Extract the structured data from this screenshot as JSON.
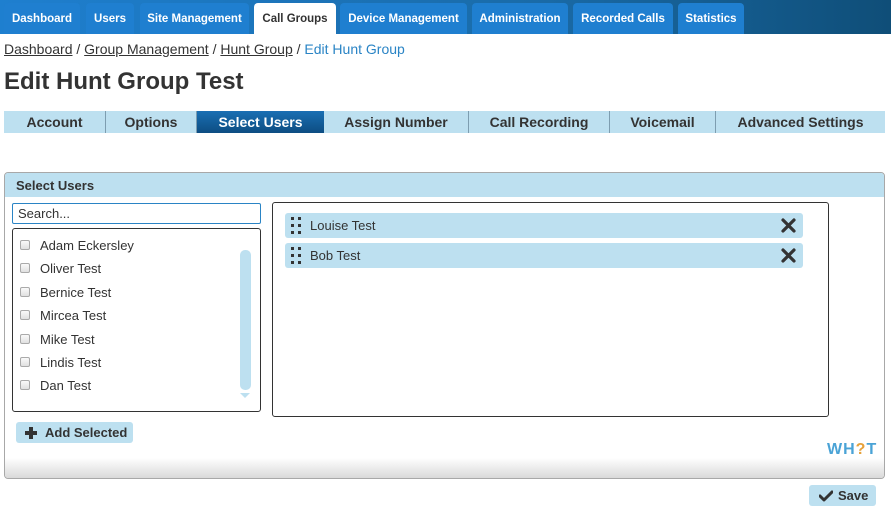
{
  "nav": {
    "tabs": [
      {
        "label": "Dashboard"
      },
      {
        "label": "Users"
      },
      {
        "label": "Site Management"
      },
      {
        "label": "Call Groups"
      },
      {
        "label": "Device Management"
      },
      {
        "label": "Administration"
      },
      {
        "label": "Recorded Calls"
      },
      {
        "label": "Statistics"
      }
    ],
    "active": "Call Groups"
  },
  "breadcrumb": {
    "items": [
      "Dashboard",
      "Group Management",
      "Hunt Group"
    ],
    "current": "Edit Hunt Group",
    "separator": "/"
  },
  "page": {
    "title": "Edit Hunt Group Test"
  },
  "subtabs": {
    "items": [
      {
        "label": "Account"
      },
      {
        "label": "Options"
      },
      {
        "label": "Select Users"
      },
      {
        "label": "Assign Number"
      },
      {
        "label": "Call Recording"
      },
      {
        "label": "Voicemail"
      },
      {
        "label": "Advanced Settings"
      }
    ],
    "active": "Select Users"
  },
  "panel": {
    "title": "Select Users",
    "search": {
      "placeholder": "Search...",
      "value": ""
    },
    "available_users": [
      {
        "name": "Adam Eckersley",
        "checked": false
      },
      {
        "name": "Oliver Test",
        "checked": false
      },
      {
        "name": "Bernice Test",
        "checked": false
      },
      {
        "name": "Mircea Test",
        "checked": false
      },
      {
        "name": "Mike Test",
        "checked": false
      },
      {
        "name": "Lindis Test",
        "checked": false
      },
      {
        "name": "Dan Test",
        "checked": false
      }
    ],
    "add_button": {
      "label": "Add Selected",
      "icon": "plus-icon"
    },
    "selected_users": [
      {
        "name": "Louise Test",
        "icon": "drag-handle-icon",
        "remove_icon": "close-icon"
      },
      {
        "name": "Bob Test",
        "icon": "drag-handle-icon",
        "remove_icon": "close-icon"
      }
    ]
  },
  "logo": {
    "text_a": "WH",
    "text_q": "?",
    "text_b": "T"
  },
  "save_button": {
    "label": "Save",
    "icon": "checkmark-icon"
  },
  "colors": {
    "nav_blue": "#1f7fd0",
    "light_blue": "#bde0f0",
    "active_tab": "#0d4d82",
    "link_blue": "#2a84c5",
    "logo_orange": "#e6a13a"
  }
}
